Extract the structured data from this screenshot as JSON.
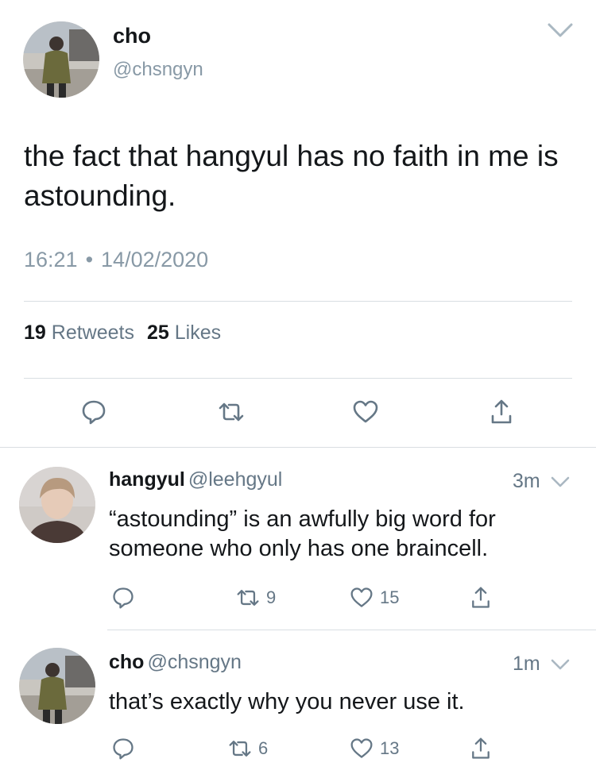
{
  "main_tweet": {
    "author_name": "cho",
    "author_handle": "@chsngyn",
    "text": "the fact that hangyul has no faith in me is astounding.",
    "time": "16:21",
    "separator": "•",
    "date": "14/02/2020",
    "retweets_count": "19",
    "retweets_label": "Retweets",
    "likes_count": "25",
    "likes_label": "Likes"
  },
  "replies": [
    {
      "author_name": "hangyul",
      "author_handle": "@leehgyul",
      "time": "3m",
      "text": "“astounding” is an awfully big word for someone who only has one braincell.",
      "retweets": "9",
      "likes": "15"
    },
    {
      "author_name": "cho",
      "author_handle": "@chsngyn",
      "time": "1m",
      "text": "that’s exactly why you never use it.",
      "retweets": "6",
      "likes": "13"
    }
  ],
  "icons": {
    "reply": "speech-bubble-icon",
    "retweet": "retweet-icon",
    "like": "heart-icon",
    "share": "share-icon",
    "more": "chevron-down-icon"
  },
  "colors": {
    "text": "#14171a",
    "muted": "#8899a6",
    "icon": "#657786",
    "divider": "#d9dee2"
  }
}
